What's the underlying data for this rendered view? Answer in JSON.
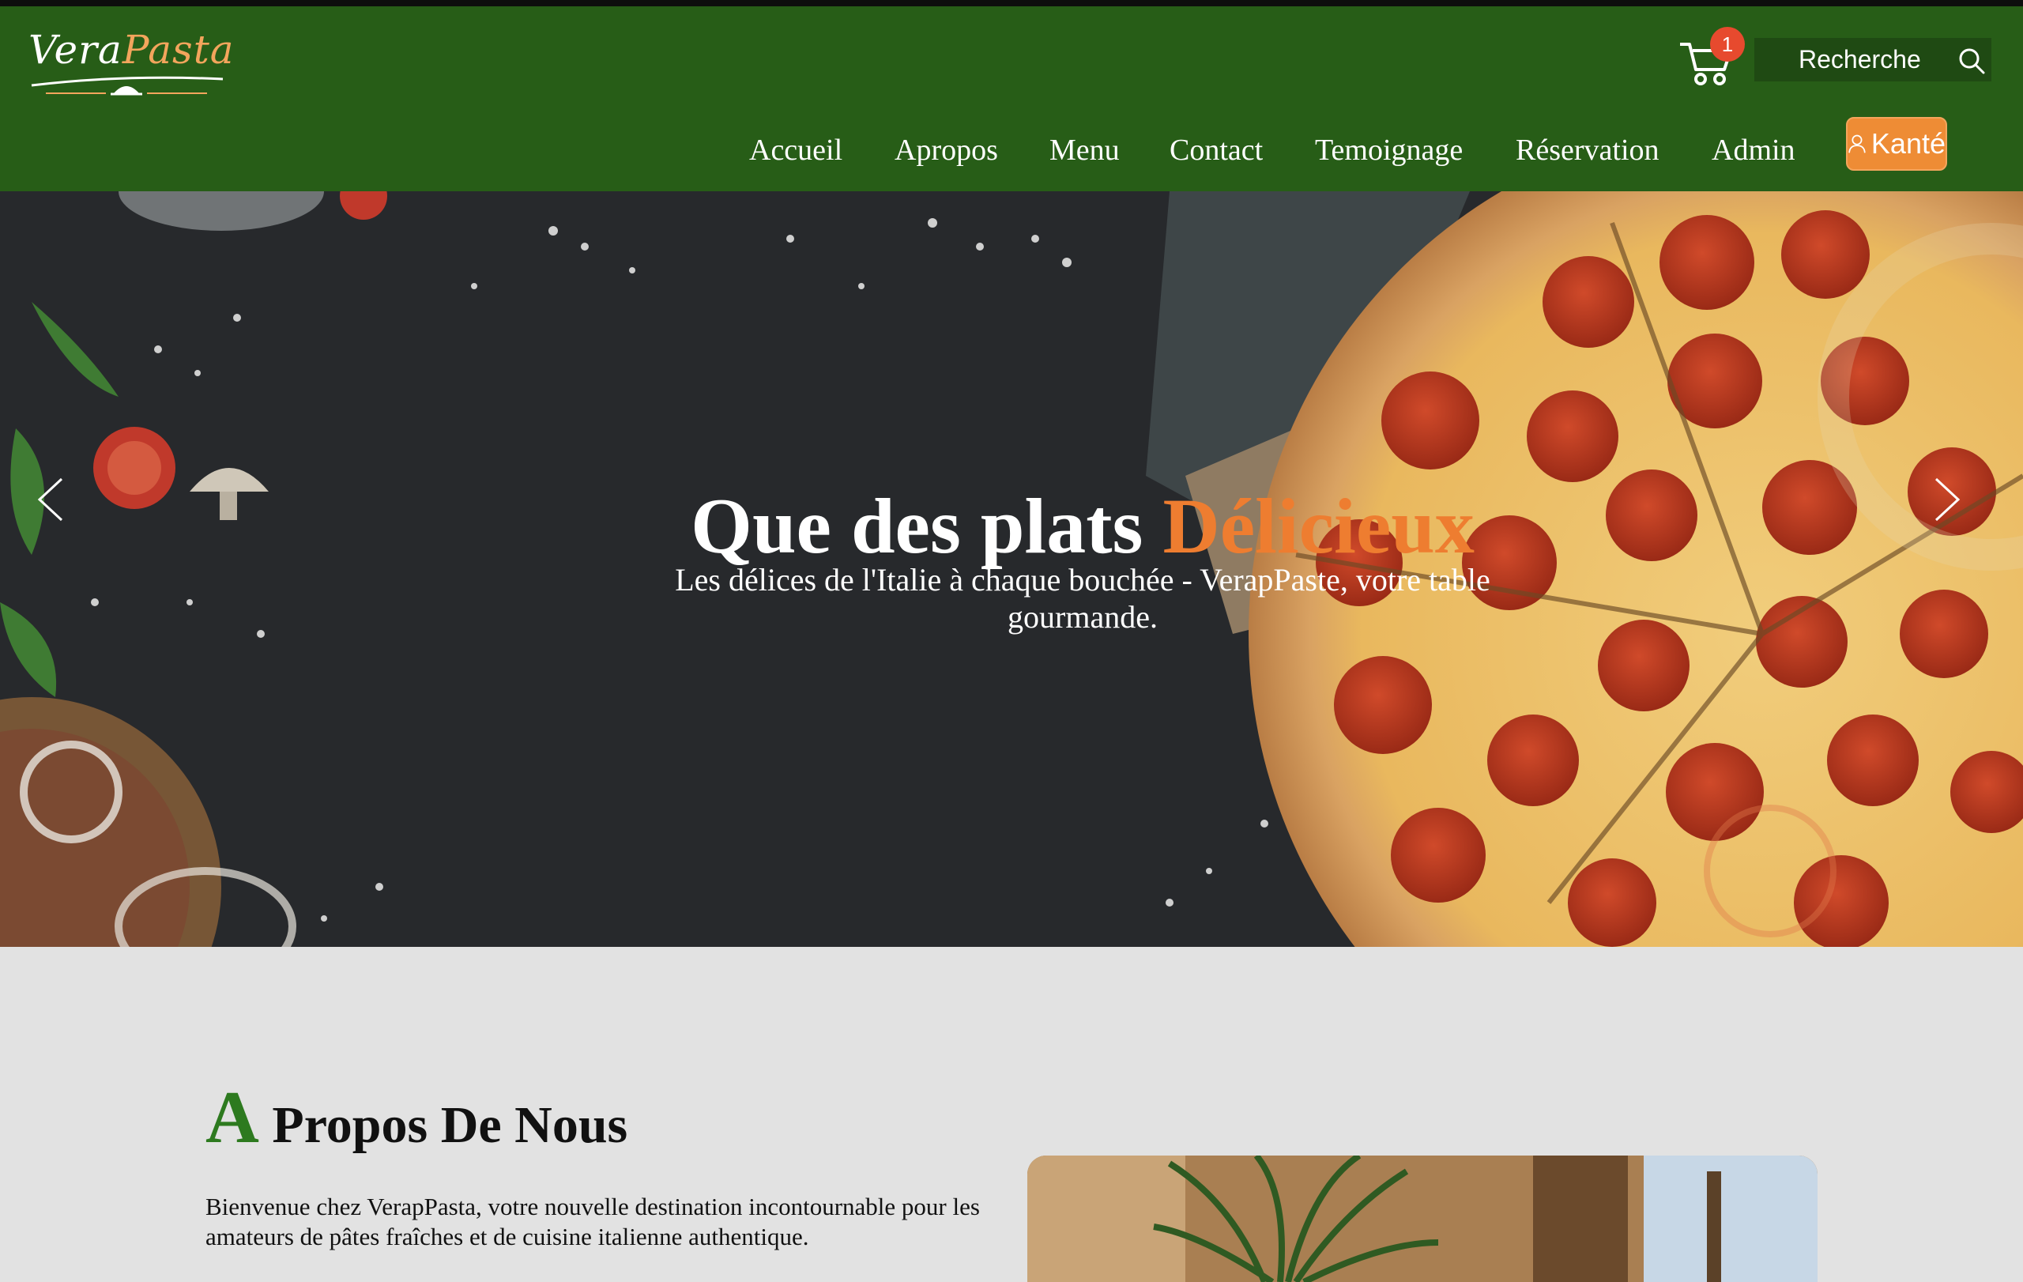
{
  "brand": {
    "logo_main": "Vera",
    "logo_accent": "Pasta"
  },
  "cart": {
    "count": "1"
  },
  "search": {
    "placeholder": "Recherche"
  },
  "nav": {
    "items": [
      "Accueil",
      "Apropos",
      "Menu",
      "Contact",
      "Temoignage",
      "Réservation",
      "Admin"
    ],
    "user_label": "Kanté"
  },
  "hero": {
    "title_main": "Que des plats ",
    "title_highlight": "Délicieux",
    "subtitle": "Les délices de l'Italie à chaque bouchée - VerapPaste, votre table gourmande."
  },
  "about": {
    "title_initial": "A",
    "title_rest": " Propos De Nous",
    "text": "Bienvenue chez VerapPasta, votre nouvelle destination incontournable pour les amateurs de pâtes fraîches et de cuisine italienne authentique."
  },
  "colors": {
    "header_green": "#275d17",
    "accent_orange": "#ee7d30",
    "title_green": "#2d7a1f",
    "badge_red": "#e74a2e",
    "page_bg": "#e2e2e2"
  },
  "icons": [
    "cart-icon",
    "search-icon",
    "user-icon",
    "chevron-left-icon",
    "chevron-right-icon"
  ]
}
